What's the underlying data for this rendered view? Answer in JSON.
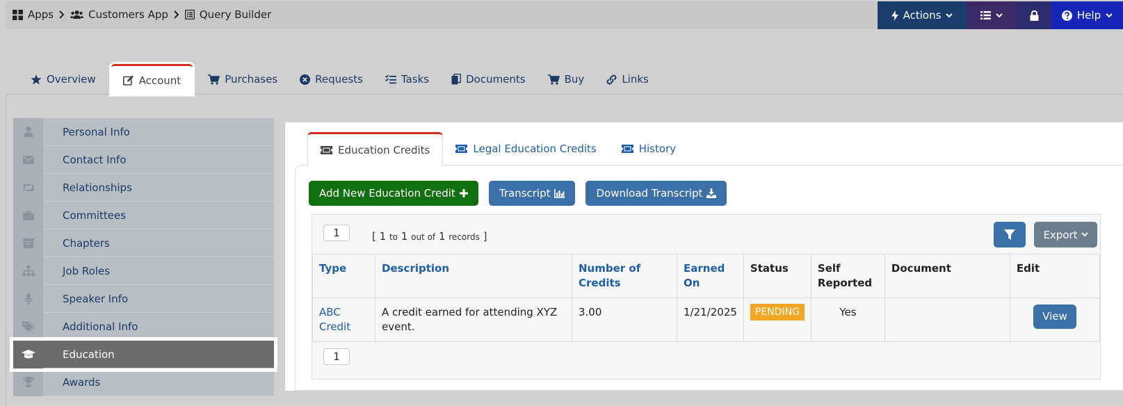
{
  "breadcrumb": [
    {
      "label": "Apps",
      "icon": "grid-icon"
    },
    {
      "label": "Customers App",
      "icon": "users-icon"
    },
    {
      "label": "Query Builder",
      "icon": "list-box-icon"
    }
  ],
  "topbar": {
    "actions_label": "Actions",
    "help_label": "Help"
  },
  "main_tabs": [
    {
      "label": "Overview",
      "icon": "star-icon"
    },
    {
      "label": "Account",
      "icon": "edit-icon",
      "active": true
    },
    {
      "label": "Purchases",
      "icon": "cart-icon"
    },
    {
      "label": "Requests",
      "icon": "circle-x-icon"
    },
    {
      "label": "Tasks",
      "icon": "tasks-icon"
    },
    {
      "label": "Documents",
      "icon": "documents-icon"
    },
    {
      "label": "Buy",
      "icon": "cart-icon"
    },
    {
      "label": "Links",
      "icon": "link-icon"
    }
  ],
  "sidebar": {
    "items": [
      {
        "label": "Personal Info",
        "icon": "user-icon"
      },
      {
        "label": "Contact Info",
        "icon": "envelope-icon"
      },
      {
        "label": "Relationships",
        "icon": "retweet-icon"
      },
      {
        "label": "Committees",
        "icon": "briefcase-icon"
      },
      {
        "label": "Chapters",
        "icon": "archive-icon"
      },
      {
        "label": "Job Roles",
        "icon": "sitemap-icon"
      },
      {
        "label": "Speaker Info",
        "icon": "microphone-icon"
      },
      {
        "label": "Additional Info",
        "icon": "tags-icon"
      },
      {
        "label": "Education",
        "icon": "graduation-cap-icon",
        "active": true
      },
      {
        "label": "Awards",
        "icon": "trophy-icon"
      }
    ]
  },
  "sub_tabs": [
    {
      "label": "Education Credits",
      "icon": "ticket-icon",
      "active": true
    },
    {
      "label": "Legal Education Credits",
      "icon": "ticket-icon"
    },
    {
      "label": "History",
      "icon": "ticket-icon"
    }
  ],
  "buttons": {
    "add_new": "Add New Education Credit",
    "transcript": "Transcript",
    "download_transcript": "Download Transcript",
    "export": "Export"
  },
  "pager": {
    "page": "1",
    "from": "1",
    "to_word": "to",
    "to": "1",
    "out_of": "out of",
    "total": "1",
    "records_word": "records"
  },
  "table": {
    "headers": {
      "type": "Type",
      "description": "Description",
      "credits": "Number of Credits",
      "earned": "Earned On",
      "status": "Status",
      "self_reported": "Self Reported",
      "document": "Document",
      "edit": "Edit"
    },
    "rows": [
      {
        "type": "ABC Credit",
        "description": "A credit earned for attending XYZ event.",
        "credits": "3.00",
        "earned": "1/21/2025",
        "status": "PENDING",
        "self_reported": "Yes",
        "document": "",
        "edit": "View"
      }
    ]
  },
  "colors": {
    "accent_tab": "#d0301f",
    "primary_button": "#3a6fa8",
    "add_button": "#107010",
    "status_pending": "#f5a623"
  }
}
